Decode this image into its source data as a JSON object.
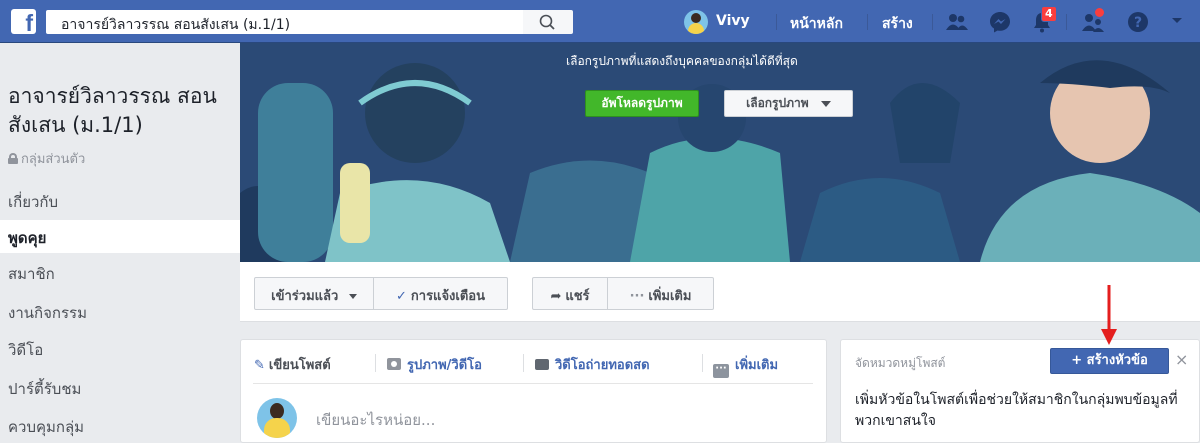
{
  "topbar": {
    "search_value": "อาจารย์วิลาวรรณ สอนสังเสน (ม.1/1)",
    "user_name": "Vivy",
    "home": "หน้าหลัก",
    "create": "สร้าง",
    "notification_count": "4"
  },
  "group": {
    "title": "อาจารย์วิลาวรรณ สอนสังเสน (ม.1/1)",
    "privacy": "กลุ่มส่วนตัว"
  },
  "sidebar": {
    "items": [
      {
        "label": "เกี่ยวกับ"
      },
      {
        "label": "พูดคุย"
      },
      {
        "label": "สมาชิก"
      },
      {
        "label": "งานกิจกรรม"
      },
      {
        "label": "วิดีโอ"
      },
      {
        "label": "ปาร์ตี้รับชม"
      },
      {
        "label": "ควบคุมกลุ่ม"
      }
    ]
  },
  "cover": {
    "hint": "เลือกรูปภาพที่แสดงถึงบุคคลของกลุ่มได้ดีที่สุด",
    "upload": "อัพโหลดรูปภาพ",
    "choose": "เลือกรูปภาพ"
  },
  "actions": {
    "joined": "เข้าร่วมแล้ว",
    "notifications": "การแจ้งเตือน",
    "share": "แชร์",
    "more": "เพิ่มเติม"
  },
  "composer": {
    "write_post": "เขียนโพสต์",
    "photo_video": "รูปภาพ/วิดีโอ",
    "live_video": "วิดีโอถ่ายทอดสด",
    "more": "เพิ่มเติม",
    "placeholder": "เขียนอะไรหน่อย..."
  },
  "topics": {
    "title": "จัดหมวดหมู่โพสต์",
    "create_button": "+ สร้างหัวข้อ",
    "close": "×",
    "description": "เพิ่มหัวข้อในโพสต์เพื่อช่วยให้สมาชิกในกลุ่มพบข้อมูลที่พวกเขาสนใจ"
  },
  "colors": {
    "brand": "#4267b2",
    "upload_green": "#42b72a",
    "notification_red": "#fa3e3e",
    "arrow_red": "#e41e1e"
  }
}
